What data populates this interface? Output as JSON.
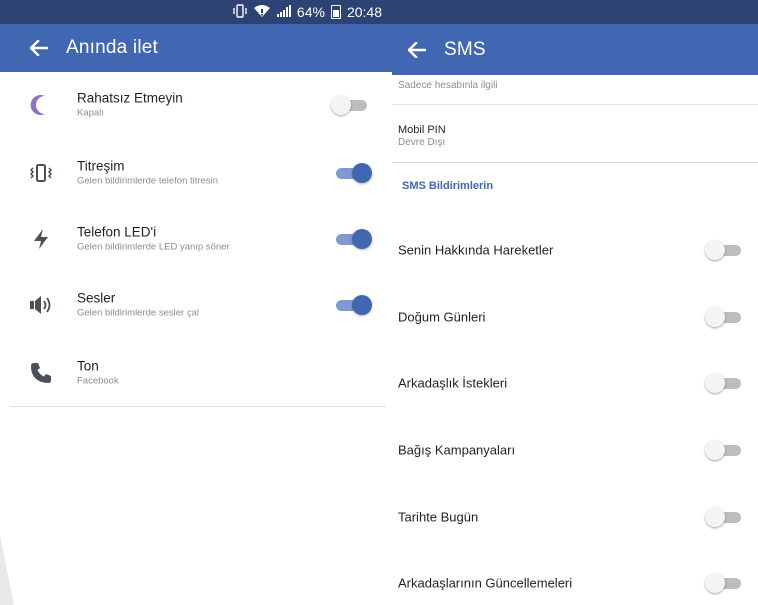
{
  "status_bar": {
    "battery_percent": "64%",
    "time": "20:48",
    "icons": [
      "vibrate-icon",
      "wifi-icon",
      "signal-icon",
      "battery-icon"
    ]
  },
  "left": {
    "title": "Anında ilet",
    "items": [
      {
        "title": "Rahatsız Etmeyin",
        "sub": "Kapalı",
        "icon": "moon-icon",
        "toggle": false
      },
      {
        "title": "Titreşim",
        "sub": "Gelen bildirimlerde telefon titresin",
        "icon": "vibrate-icon",
        "toggle": true
      },
      {
        "title": "Telefon LED'i",
        "sub": "Gelen bildirimlerde LED yanıp söner",
        "icon": "flash-icon",
        "toggle": true
      },
      {
        "title": "Sesler",
        "sub": "Gelen bildirimlerde sesler çal",
        "icon": "speaker-icon",
        "toggle": true
      },
      {
        "title": "Ton",
        "sub": "Facebook",
        "icon": "phone-icon",
        "toggle": null
      }
    ]
  },
  "right": {
    "title": "SMS",
    "partial_sub": "Sadece hesabınla ilgili",
    "mobile_pin": {
      "title": "Mobil PIN",
      "sub": "Devre Dışı"
    },
    "section_label": "SMS Bildirimlerin",
    "rows": [
      {
        "label": "Senin Hakkında Hareketler",
        "toggle": false
      },
      {
        "label": "Doğum Günleri",
        "toggle": false
      },
      {
        "label": "Arkadaşlık İstekleri",
        "toggle": false
      },
      {
        "label": "Bağış Kampanyaları",
        "toggle": false
      },
      {
        "label": "Tarihte Bugün",
        "toggle": false
      },
      {
        "label": "Arkadaşlarının Güncellemeleri",
        "toggle": false
      }
    ]
  },
  "colors": {
    "status_bar": "#2d4373",
    "app_bar": "#4267b2",
    "accent": "#4267b2",
    "moon_icon": "#8c72cb"
  }
}
